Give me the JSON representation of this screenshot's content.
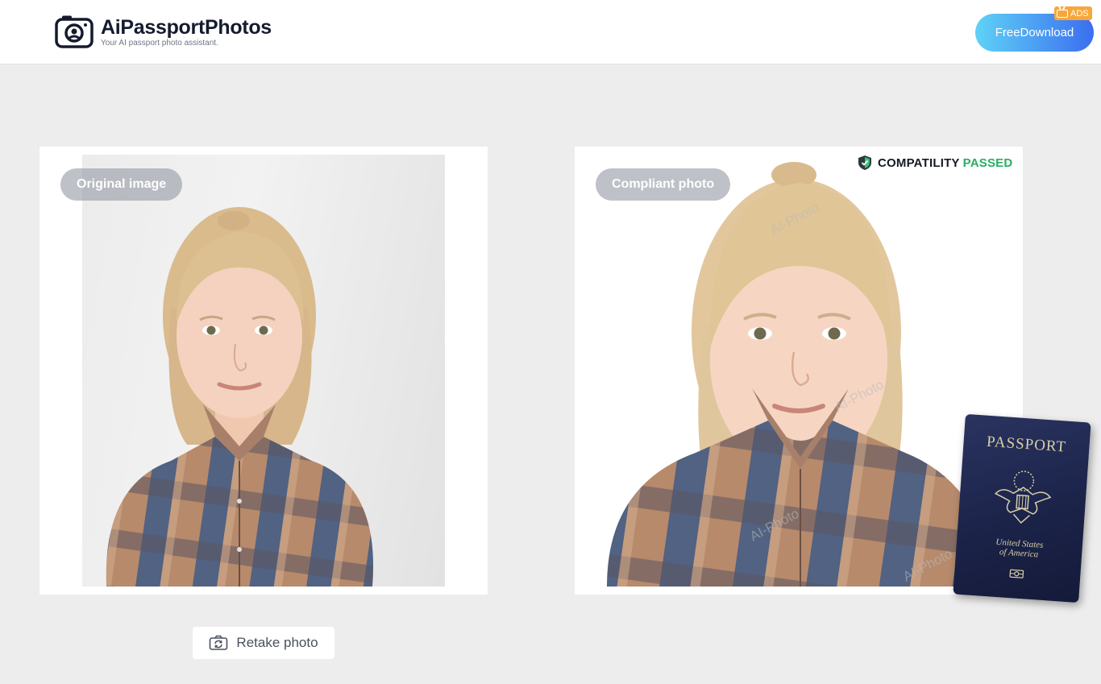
{
  "header": {
    "logo_title": "AiPassportPhotos",
    "logo_tagline": "Your AI passport photo assistant.",
    "download_label": "FreeDownload",
    "ads_label": "ADS"
  },
  "original_panel": {
    "label": "Original image"
  },
  "compliant_panel": {
    "label": "Compliant photo",
    "compat_word": "COMPATILITY",
    "compat_status": "PASSED",
    "watermark": "AI-Photo"
  },
  "passport": {
    "title": "PASSPORT",
    "country_line1": "United States",
    "country_line2": "of America"
  },
  "retake_label": "Retake photo",
  "colors": {
    "accent_start": "#5fd2f6",
    "accent_end": "#3b6ef0",
    "passed_green": "#27ae60",
    "ads_orange": "#f7a73a",
    "passport_navy": "#1b2349"
  }
}
